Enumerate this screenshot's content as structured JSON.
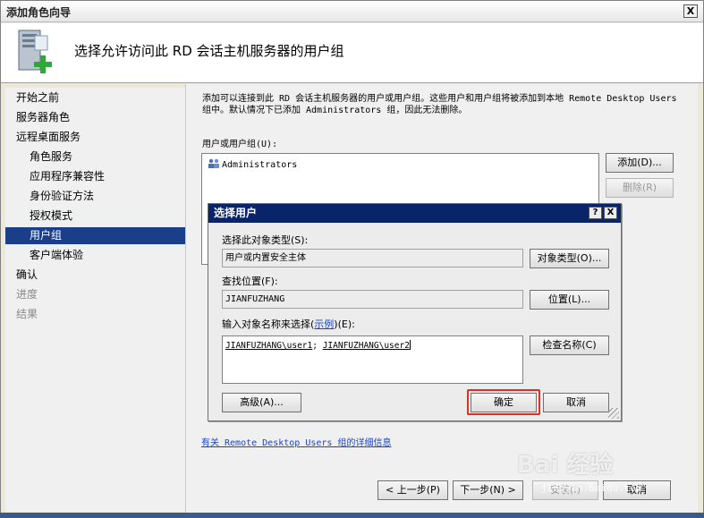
{
  "window": {
    "title": "添加角色向导",
    "close_label": "X"
  },
  "header": {
    "title": "选择允许访问此 RD 会话主机服务器的用户组"
  },
  "sidebar": {
    "items": [
      {
        "label": "开始之前"
      },
      {
        "label": "服务器角色"
      },
      {
        "label": "远程桌面服务"
      },
      {
        "label": "角色服务"
      },
      {
        "label": "应用程序兼容性"
      },
      {
        "label": "身份验证方法"
      },
      {
        "label": "授权模式"
      },
      {
        "label": "用户组"
      },
      {
        "label": "客户端体验"
      },
      {
        "label": "确认"
      },
      {
        "label": "进度"
      },
      {
        "label": "结果"
      }
    ]
  },
  "main": {
    "description": "添加可以连接到此 RD 会话主机服务器的用户或用户组。这些用户和用户组将被添加到本地 Remote Desktop Users 组中。默认情况下已添加 Administrators 组，因此无法删除。",
    "user_group_label": "用户或用户组(U):",
    "list_items": [
      "Administrators"
    ],
    "add_button": "添加(D)...",
    "remove_button": "删除(R)",
    "info_link": "有关 Remote Desktop Users 组的详细信息",
    "prev_button": "< 上一步(P)",
    "next_button": "下一步(N) >",
    "install_button": "安装(I)",
    "cancel_button": "取消"
  },
  "dialog": {
    "title": "选择用户",
    "help_label": "?",
    "close_label": "X",
    "object_type_label": "选择此对象类型(S):",
    "object_type_value": "用户或内置安全主体",
    "object_type_button": "对象类型(O)...",
    "location_label": "查找位置(F):",
    "location_value": "JIANFUZHANG",
    "location_button": "位置(L)...",
    "names_label_prefix": "输入对象名称来选择(",
    "names_label_link": "示例",
    "names_label_suffix": ")(E):",
    "name1": "JIANFUZHANG\\user1",
    "separator": "; ",
    "name2": "JIANFUZHANG\\user2",
    "check_names_button": "检查名称(C)",
    "advanced_button": "高级(A)...",
    "ok_button": "确定",
    "cancel_button": "取消"
  },
  "watermark": {
    "brand": "Bai 经验",
    "url": "jingyan.baidu.com"
  },
  "colors": {
    "selection": "#1a3e8a",
    "dialog_title": "#0a246a",
    "highlight": "#e03020",
    "link": "#1a45c8"
  }
}
